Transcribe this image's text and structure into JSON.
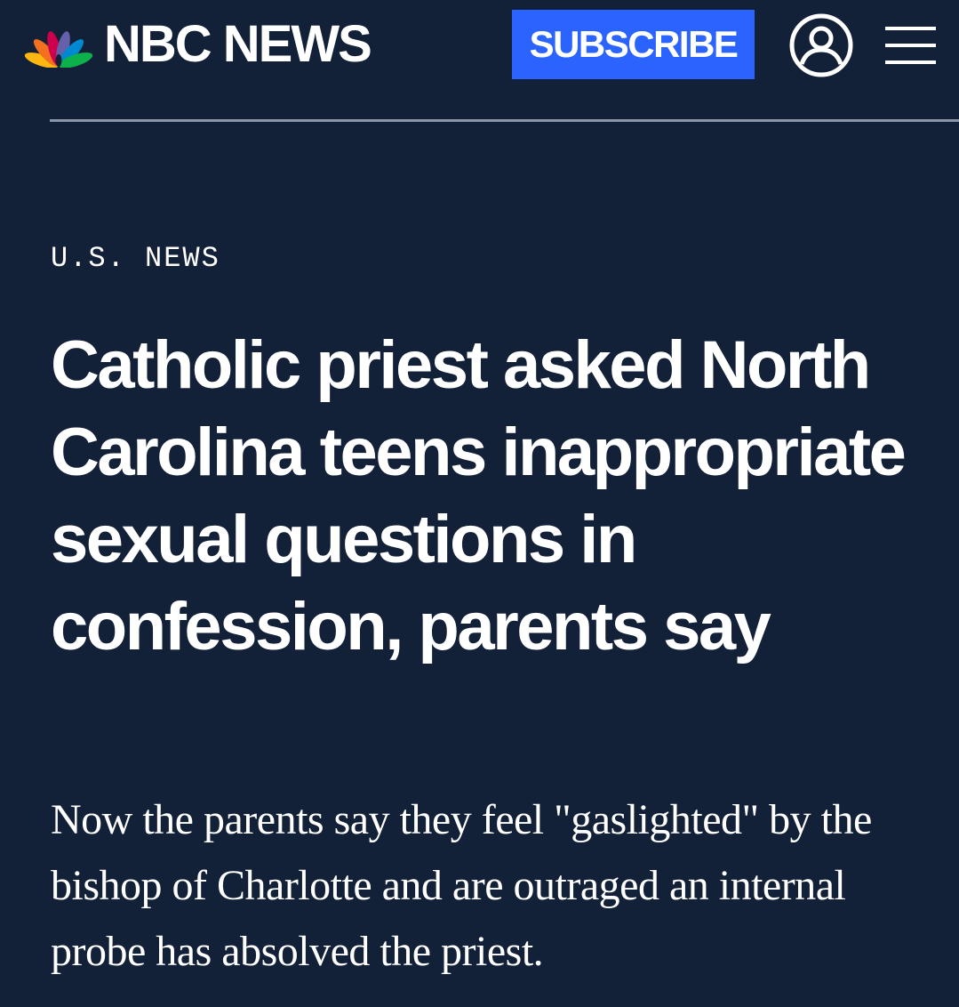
{
  "header": {
    "logo_text": "NBC NEWS",
    "subscribe_label": "SUBSCRIBE",
    "account_icon": "user-circle-icon",
    "menu_icon": "hamburger-menu-icon"
  },
  "article": {
    "section": "U.S. NEWS",
    "headline": "Catholic priest asked North Carolina teens inappropriate sexual questions in confession, parents say",
    "dek": "Now the parents say they feel \"gaslighted\" by the bishop of Charlotte and are outraged an internal probe has absolved the priest."
  },
  "colors": {
    "background": "#122038",
    "subscribe_button": "#2b63ff",
    "text": "#ffffff",
    "divider": "#8a94a6"
  }
}
